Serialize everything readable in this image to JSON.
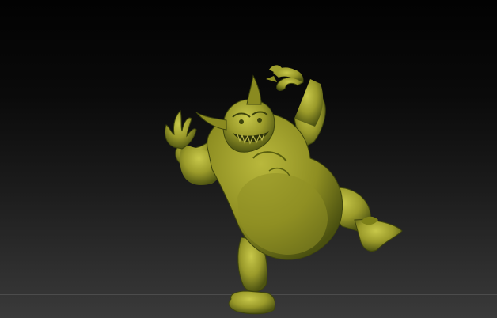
{
  "colors": {
    "background_top": "#020202",
    "background_bottom": "#3a3a3a",
    "model_base": "#9a9a2a",
    "model_shadow": "#4e5412",
    "model_highlight": "#c8c84a"
  },
  "icons": {
    "model": "sculpted-ogre-creature"
  }
}
